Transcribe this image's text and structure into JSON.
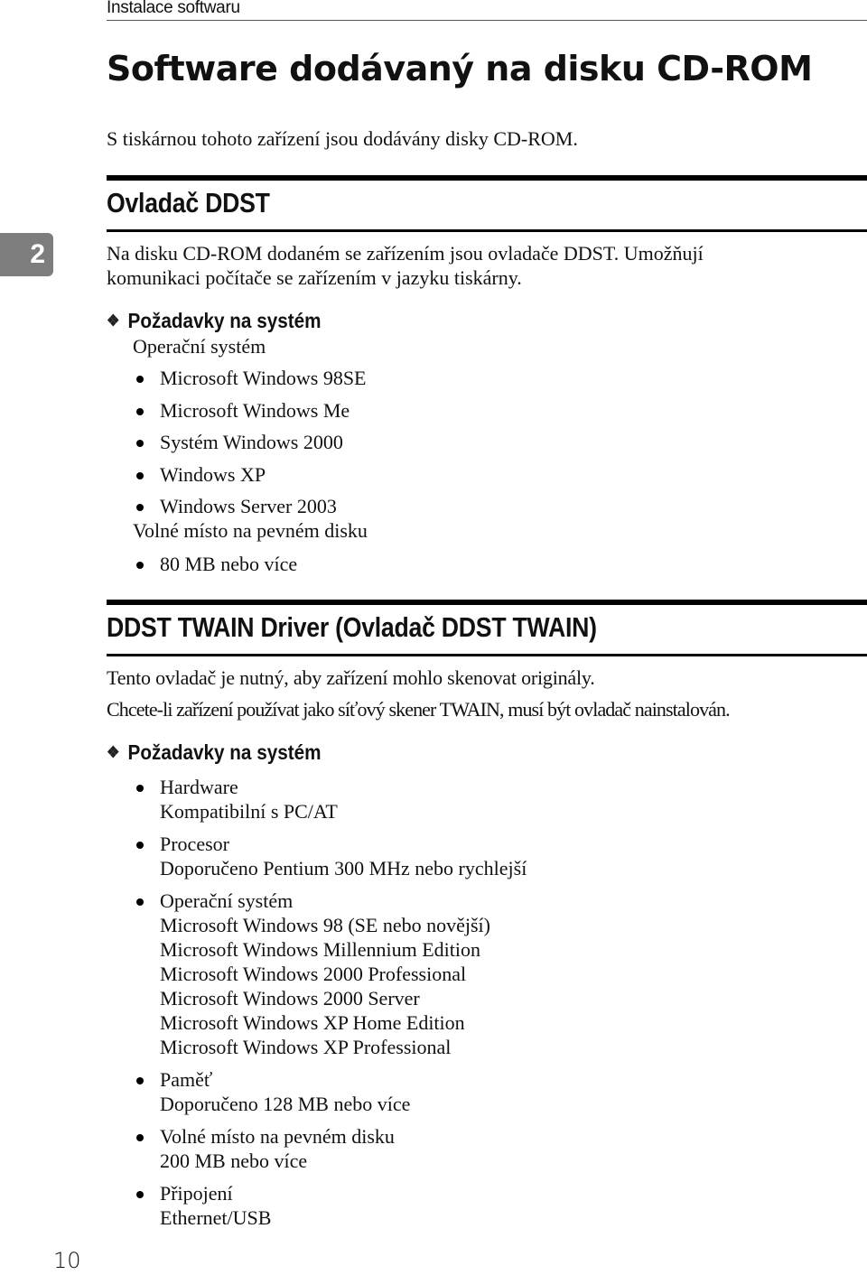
{
  "running_head": "Instalace softwaru",
  "page_title": "Software dodávaný na disku CD-ROM",
  "intro": "S tiskárnou tohoto zařízení jsou dodávány disky CD-ROM.",
  "chapter_tab": "2",
  "section1": {
    "heading": "Ovladač DDST",
    "paragraph_lines": [
      "Na disku CD-ROM dodaném se zařízením jsou ovladače DDST. Umožňují",
      "komunikaci počítače se zařízením v jazyku tiskárny."
    ],
    "requirements": {
      "heading": "Požadavky na systém",
      "os_label": "Operační systém",
      "os_items": [
        "Microsoft Windows 98SE",
        "Microsoft Windows Me",
        "Systém Windows 2000",
        "Windows XP",
        "Windows Server 2003"
      ],
      "disk_label": "Volné místo na pevném disku",
      "disk_items": [
        "80 MB nebo více"
      ]
    }
  },
  "section2": {
    "heading": "DDST TWAIN Driver (Ovladač DDST TWAIN)",
    "paragraphs": [
      "Tento ovladač je nutný, aby zařízení mohlo skenovat originály.",
      "Chcete-li zařízení používat jako síťový skener TWAIN, musí být ovladač nainstalován."
    ],
    "requirements": {
      "heading": "Požadavky na systém",
      "groups": [
        {
          "title": "Hardware",
          "lines": [
            "Kompatibilní s PC/AT"
          ]
        },
        {
          "title": "Procesor",
          "lines": [
            "Doporučeno Pentium 300 MHz nebo rychlejší"
          ]
        },
        {
          "title": "Operační systém",
          "lines": [
            "Microsoft Windows 98 (SE nebo novější)",
            "Microsoft Windows Millennium Edition",
            "Microsoft Windows 2000 Professional",
            "Microsoft Windows 2000 Server",
            "Microsoft Windows XP Home Edition",
            "Microsoft Windows XP Professional"
          ]
        },
        {
          "title": "Paměť",
          "lines": [
            "Doporučeno 128 MB nebo více"
          ]
        },
        {
          "title": "Volné místo na pevném disku",
          "lines": [
            "200 MB nebo více"
          ]
        },
        {
          "title": "Připojení",
          "lines": [
            "Ethernet/USB"
          ]
        }
      ]
    }
  },
  "page_number": "10"
}
